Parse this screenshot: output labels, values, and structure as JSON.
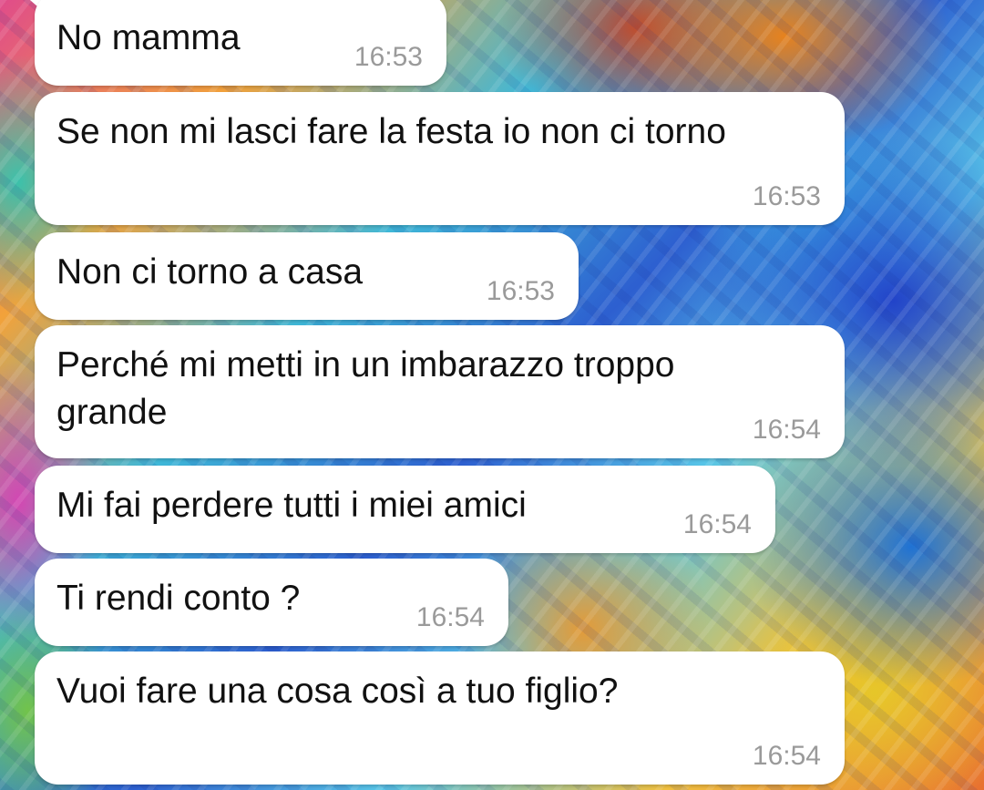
{
  "chat": {
    "messages": [
      {
        "text": "No mamma",
        "time": "16:53"
      },
      {
        "text": "Se non mi lasci fare la festa io non ci torno",
        "time": "16:53"
      },
      {
        "text": "Non ci torno a casa",
        "time": "16:53"
      },
      {
        "text": "Perché mi metti in un imbarazzo troppo grande",
        "time": "16:54"
      },
      {
        "text": "Mi fai perdere tutti i miei amici",
        "time": "16:54"
      },
      {
        "text": "Ti rendi conto ?",
        "time": "16:54"
      },
      {
        "text": "Vuoi fare una cosa così a tuo figlio?",
        "time": "16:54"
      }
    ]
  },
  "colors": {
    "bubble_bg": "#ffffff",
    "message_text": "#111111",
    "timestamp_text": "#9a9a9a",
    "wallpaper": "psychedelic-soap-bubble-swirl"
  }
}
